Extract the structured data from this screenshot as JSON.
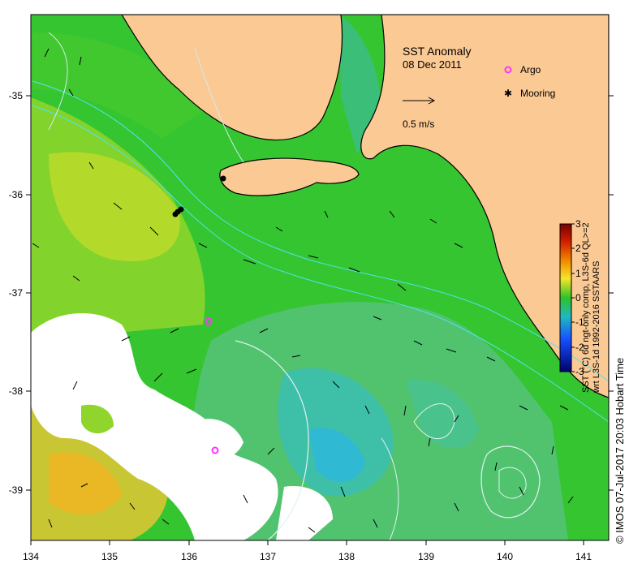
{
  "map": {
    "title": "SST Anomaly",
    "date": "08 Dec 2011",
    "scale_label": "0.5 m/s",
    "legend": {
      "argo_label": "Argo",
      "mooring_label": "Mooring",
      "argo_color": "#ff33ff",
      "mooring_color": "#000000"
    },
    "x_ticks": [
      "134",
      "135",
      "136",
      "137",
      "138",
      "139",
      "140",
      "141"
    ],
    "y_ticks": [
      "-35",
      "-36",
      "-37",
      "-38",
      "-39"
    ],
    "colorbar": {
      "ticks": [
        "3",
        "2",
        "1",
        "0",
        "-1",
        "-2",
        "-3"
      ],
      "title_line1": "SST (°C) 6d ngt-only comp, L3S-6d QL>=2",
      "title_line2": "wrt L3S-1d 1992-2016 SSTAARS"
    },
    "credit": "© IMOS 07-Jul-2017 20:03 Hobart Time",
    "colors": {
      "land": "#fbc994",
      "ocean_green": "#35c531",
      "anomaly_cyan": "#3cbfae",
      "cloud": "#ffffff"
    }
  }
}
